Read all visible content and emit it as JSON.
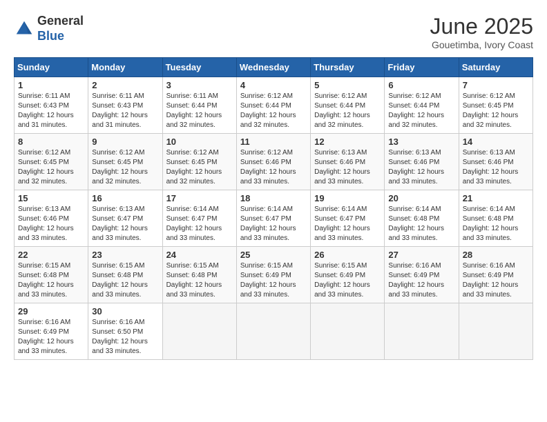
{
  "header": {
    "logo_line1": "General",
    "logo_line2": "Blue",
    "month_title": "June 2025",
    "location": "Gouetimba, Ivory Coast"
  },
  "days_of_week": [
    "Sunday",
    "Monday",
    "Tuesday",
    "Wednesday",
    "Thursday",
    "Friday",
    "Saturday"
  ],
  "weeks": [
    [
      {
        "day": "1",
        "sunrise": "6:11 AM",
        "sunset": "6:43 PM",
        "daylight": "12 hours and 31 minutes."
      },
      {
        "day": "2",
        "sunrise": "6:11 AM",
        "sunset": "6:43 PM",
        "daylight": "12 hours and 31 minutes."
      },
      {
        "day": "3",
        "sunrise": "6:11 AM",
        "sunset": "6:44 PM",
        "daylight": "12 hours and 32 minutes."
      },
      {
        "day": "4",
        "sunrise": "6:12 AM",
        "sunset": "6:44 PM",
        "daylight": "12 hours and 32 minutes."
      },
      {
        "day": "5",
        "sunrise": "6:12 AM",
        "sunset": "6:44 PM",
        "daylight": "12 hours and 32 minutes."
      },
      {
        "day": "6",
        "sunrise": "6:12 AM",
        "sunset": "6:44 PM",
        "daylight": "12 hours and 32 minutes."
      },
      {
        "day": "7",
        "sunrise": "6:12 AM",
        "sunset": "6:45 PM",
        "daylight": "12 hours and 32 minutes."
      }
    ],
    [
      {
        "day": "8",
        "sunrise": "6:12 AM",
        "sunset": "6:45 PM",
        "daylight": "12 hours and 32 minutes."
      },
      {
        "day": "9",
        "sunrise": "6:12 AM",
        "sunset": "6:45 PM",
        "daylight": "12 hours and 32 minutes."
      },
      {
        "day": "10",
        "sunrise": "6:12 AM",
        "sunset": "6:45 PM",
        "daylight": "12 hours and 32 minutes."
      },
      {
        "day": "11",
        "sunrise": "6:12 AM",
        "sunset": "6:46 PM",
        "daylight": "12 hours and 33 minutes."
      },
      {
        "day": "12",
        "sunrise": "6:13 AM",
        "sunset": "6:46 PM",
        "daylight": "12 hours and 33 minutes."
      },
      {
        "day": "13",
        "sunrise": "6:13 AM",
        "sunset": "6:46 PM",
        "daylight": "12 hours and 33 minutes."
      },
      {
        "day": "14",
        "sunrise": "6:13 AM",
        "sunset": "6:46 PM",
        "daylight": "12 hours and 33 minutes."
      }
    ],
    [
      {
        "day": "15",
        "sunrise": "6:13 AM",
        "sunset": "6:46 PM",
        "daylight": "12 hours and 33 minutes."
      },
      {
        "day": "16",
        "sunrise": "6:13 AM",
        "sunset": "6:47 PM",
        "daylight": "12 hours and 33 minutes."
      },
      {
        "day": "17",
        "sunrise": "6:14 AM",
        "sunset": "6:47 PM",
        "daylight": "12 hours and 33 minutes."
      },
      {
        "day": "18",
        "sunrise": "6:14 AM",
        "sunset": "6:47 PM",
        "daylight": "12 hours and 33 minutes."
      },
      {
        "day": "19",
        "sunrise": "6:14 AM",
        "sunset": "6:47 PM",
        "daylight": "12 hours and 33 minutes."
      },
      {
        "day": "20",
        "sunrise": "6:14 AM",
        "sunset": "6:48 PM",
        "daylight": "12 hours and 33 minutes."
      },
      {
        "day": "21",
        "sunrise": "6:14 AM",
        "sunset": "6:48 PM",
        "daylight": "12 hours and 33 minutes."
      }
    ],
    [
      {
        "day": "22",
        "sunrise": "6:15 AM",
        "sunset": "6:48 PM",
        "daylight": "12 hours and 33 minutes."
      },
      {
        "day": "23",
        "sunrise": "6:15 AM",
        "sunset": "6:48 PM",
        "daylight": "12 hours and 33 minutes."
      },
      {
        "day": "24",
        "sunrise": "6:15 AM",
        "sunset": "6:48 PM",
        "daylight": "12 hours and 33 minutes."
      },
      {
        "day": "25",
        "sunrise": "6:15 AM",
        "sunset": "6:49 PM",
        "daylight": "12 hours and 33 minutes."
      },
      {
        "day": "26",
        "sunrise": "6:15 AM",
        "sunset": "6:49 PM",
        "daylight": "12 hours and 33 minutes."
      },
      {
        "day": "27",
        "sunrise": "6:16 AM",
        "sunset": "6:49 PM",
        "daylight": "12 hours and 33 minutes."
      },
      {
        "day": "28",
        "sunrise": "6:16 AM",
        "sunset": "6:49 PM",
        "daylight": "12 hours and 33 minutes."
      }
    ],
    [
      {
        "day": "29",
        "sunrise": "6:16 AM",
        "sunset": "6:49 PM",
        "daylight": "12 hours and 33 minutes."
      },
      {
        "day": "30",
        "sunrise": "6:16 AM",
        "sunset": "6:50 PM",
        "daylight": "12 hours and 33 minutes."
      },
      null,
      null,
      null,
      null,
      null
    ]
  ]
}
